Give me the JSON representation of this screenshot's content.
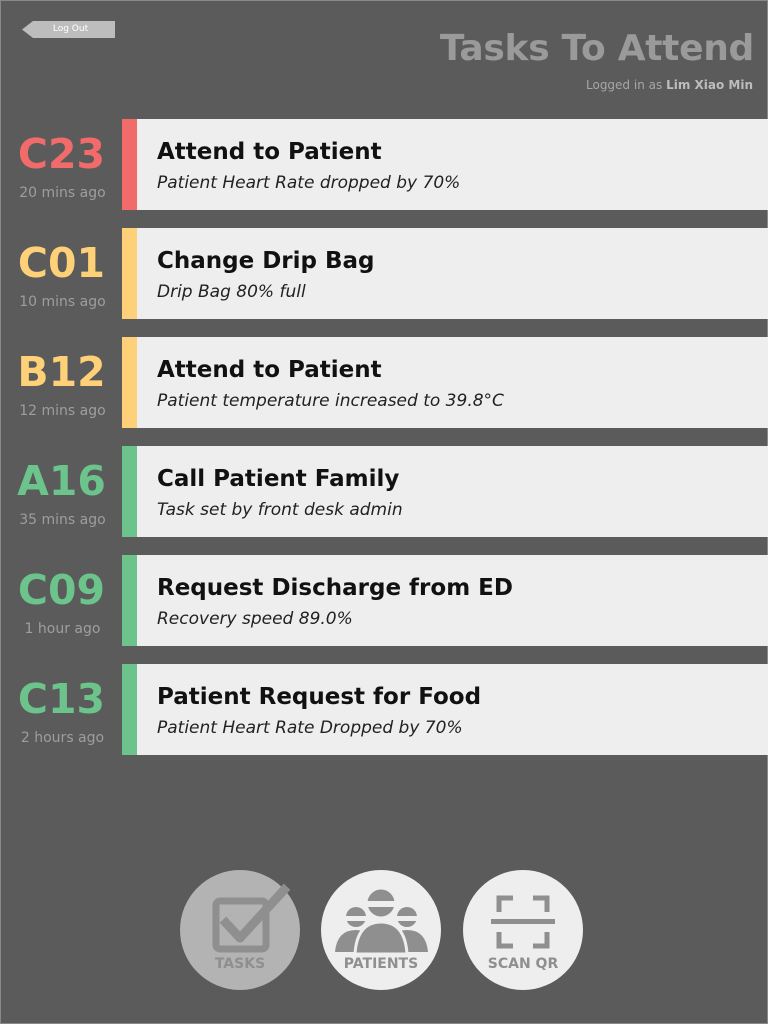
{
  "header": {
    "logout_label": "Log Out",
    "title": "Tasks To Attend",
    "logged_in_prefix": "Logged in as",
    "user_name": "Lim Xiao Min"
  },
  "colors": {
    "red": "#f26b6b",
    "yellow": "#fed077",
    "green": "#6cc38c",
    "background": "#5b5b5b",
    "card": "#eeeeee"
  },
  "tasks": [
    {
      "bed": "C23",
      "ago": "20 mins ago",
      "title": "Attend to Patient",
      "detail": "Patient Heart Rate dropped by 70%",
      "priority": "red"
    },
    {
      "bed": "C01",
      "ago": "10 mins ago",
      "title": "Change Drip Bag",
      "detail": "Drip Bag 80% full",
      "priority": "yellow"
    },
    {
      "bed": "B12",
      "ago": "12 mins ago",
      "title": "Attend to Patient",
      "detail": "Patient temperature increased to 39.8°C",
      "priority": "yellow"
    },
    {
      "bed": "A16",
      "ago": "35 mins ago",
      "title": "Call Patient Family",
      "detail": "Task set by front desk admin",
      "priority": "green"
    },
    {
      "bed": "C09",
      "ago": "1 hour ago",
      "title": "Request Discharge from ED",
      "detail": "Recovery speed 89.0%",
      "priority": "green"
    },
    {
      "bed": "C13",
      "ago": "2 hours ago",
      "title": "Patient Request for Food",
      "detail": "Patient Heart Rate Dropped by 70%",
      "priority": "green"
    }
  ],
  "nav": {
    "tasks": {
      "label": "TASKS",
      "icon": "checkbox-icon",
      "active": true
    },
    "patients": {
      "label": "PATIENTS",
      "icon": "patients-group-icon"
    },
    "scan": {
      "label": "SCAN QR",
      "icon": "qr-scan-icon"
    }
  }
}
